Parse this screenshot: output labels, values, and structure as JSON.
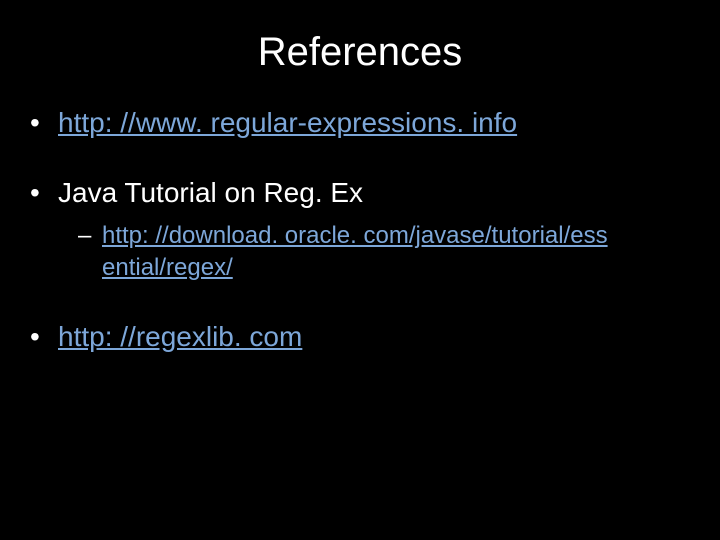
{
  "slide": {
    "title": "References",
    "bullets": [
      {
        "type": "link",
        "text": "http: //www. regular-expressions. info"
      },
      {
        "type": "text",
        "text": "Java Tutorial on Reg. Ex",
        "sub": {
          "text": "http: //download. oracle. com/javase/tutorial/ess ential/regex/"
        }
      },
      {
        "type": "link",
        "text": "http: //regexlib. com"
      }
    ],
    "bullet_char": "•",
    "dash_char": "–"
  }
}
